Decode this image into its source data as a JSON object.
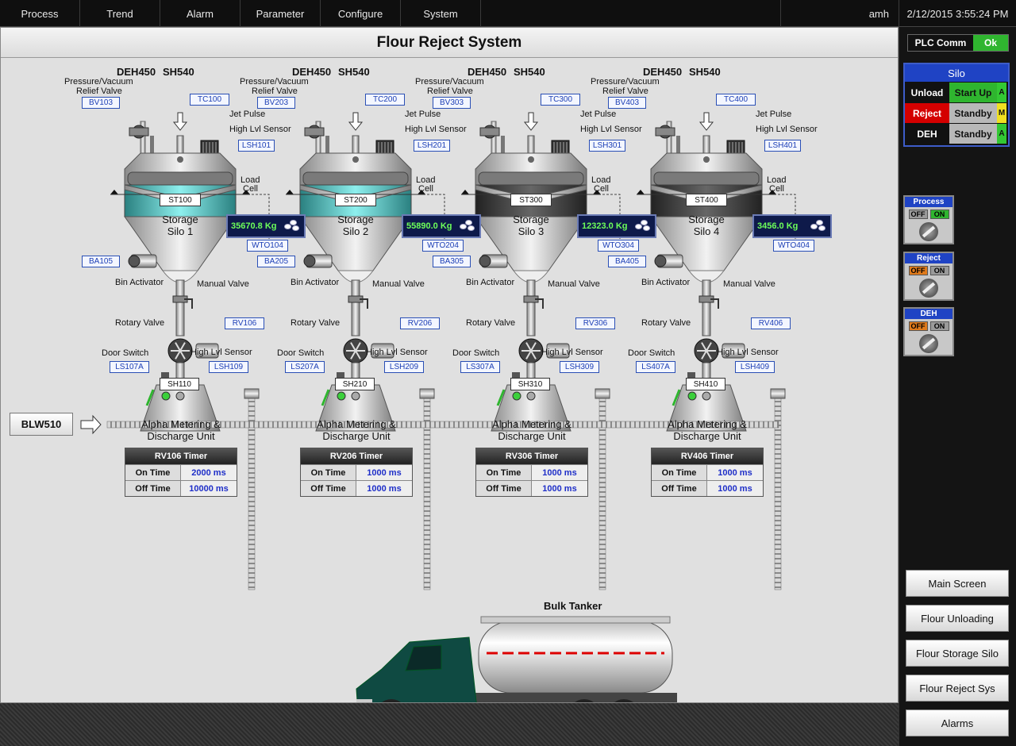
{
  "nav": {
    "tabs": [
      "Process",
      "Trend",
      "Alarm",
      "Parameter",
      "Configure",
      "System"
    ],
    "user": "amh",
    "datetime": "2/12/2015 3:55:24 PM"
  },
  "title": "Flour Reject System",
  "blower": "BLW510",
  "labels": {
    "deh": "DEH450",
    "sh": "SH540",
    "relief1": "Pressure/Vacuum",
    "relief2": "Relief Valve",
    "jet": "Jet Pulse",
    "highlvl": "High Lvl Sensor",
    "load1": "Load",
    "load2": "Cell",
    "binact": "Bin Activator",
    "manual": "Manual Valve",
    "rotary": "Rotary Valve",
    "door": "Door Switch",
    "unit1": "Alpha Metering &",
    "unit2": "Discharge Unit",
    "on_time": "On Time",
    "off_time": "Off Time"
  },
  "silos": [
    {
      "bv": "BV103",
      "tc": "TC100",
      "lsh": "LSH101",
      "st": "ST100",
      "name1": "Storage",
      "name2": "Silo 1",
      "weight": "35670.8 Kg",
      "wto": "WTO104",
      "ba": "BA105",
      "rv": "RV106",
      "ls": "LS107A",
      "lsh2": "LSH109",
      "sh": "SH110",
      "timer_title": "RV106 Timer",
      "on": "2000 ms",
      "off": "10000 ms"
    },
    {
      "bv": "BV203",
      "tc": "TC200",
      "lsh": "LSH201",
      "st": "ST200",
      "name1": "Storage",
      "name2": "Silo 2",
      "weight": "55890.0 Kg",
      "wto": "WTO204",
      "ba": "BA205",
      "rv": "RV206",
      "ls": "LS207A",
      "lsh2": "LSH209",
      "sh": "SH210",
      "timer_title": "RV206 Timer",
      "on": "1000 ms",
      "off": "1000 ms"
    },
    {
      "bv": "BV303",
      "tc": "TC300",
      "lsh": "LSH301",
      "st": "ST300",
      "name1": "Storage",
      "name2": "Silo 3",
      "weight": "12323.0 Kg",
      "wto": "WTO304",
      "ba": "BA305",
      "rv": "RV306",
      "ls": "LS307A",
      "lsh2": "LSH309",
      "sh": "SH310",
      "timer_title": "RV306 Timer",
      "on": "1000 ms",
      "off": "1000 ms"
    },
    {
      "bv": "BV403",
      "tc": "TC400",
      "lsh": "LSH401",
      "st": "ST400",
      "name1": "Storage",
      "name2": "Silo 4",
      "weight": "3456.0 Kg",
      "wto": "WTO404",
      "ba": "BA405",
      "rv": "RV406",
      "ls": "LS407A",
      "lsh2": "LSH409",
      "sh": "SH410",
      "timer_title": "RV406 Timer",
      "on": "1000 ms",
      "off": "1000 ms"
    }
  ],
  "tanker": "Bulk Tanker",
  "plc": {
    "label": "PLC Comm",
    "value": "Ok",
    "color": "#2fb52f"
  },
  "silo_panel": {
    "title": "Silo",
    "rows": [
      {
        "name": "Unload",
        "status": "Start Up",
        "ind": "A",
        "name_bg": "#111111",
        "status_bg": "#2fb52f",
        "ind_bg": "#33c833"
      },
      {
        "name": "Reject",
        "status": "Standby",
        "ind": "M",
        "name_bg": "#d40000",
        "status_bg": "#b8b8b8",
        "ind_bg": "#f0e020"
      },
      {
        "name": "DEH",
        "status": "Standby",
        "ind": "A",
        "name_bg": "#111111",
        "status_bg": "#b8b8b8",
        "ind_bg": "#33c833"
      }
    ]
  },
  "switches": [
    {
      "title": "Process",
      "off": "OFF",
      "on": "ON",
      "active": "on"
    },
    {
      "title": "Reject",
      "off": "OFF",
      "on": "ON",
      "active": "off"
    },
    {
      "title": "DEH",
      "off": "OFF",
      "on": "ON",
      "active": "off"
    }
  ],
  "nav_buttons": [
    "Main Screen",
    "Flour Unloading",
    "Flour Storage Silo",
    "Flour Reject Sys",
    "Alarms"
  ]
}
